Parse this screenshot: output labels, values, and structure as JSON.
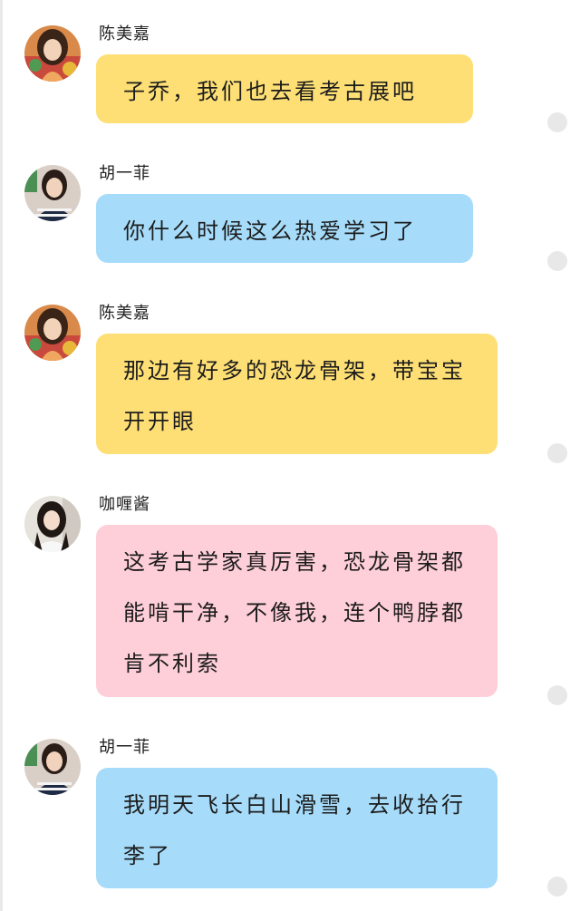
{
  "messages": [
    {
      "sender": "陈美嘉",
      "avatar": "avatar-chen-meijia",
      "text": "子乔，我们也去看考古展吧",
      "color": "yellow"
    },
    {
      "sender": "胡一菲",
      "avatar": "avatar-hu-yifei",
      "text": "你什么时候这么热爱学习了",
      "color": "blue"
    },
    {
      "sender": "陈美嘉",
      "avatar": "avatar-chen-meijia",
      "text": "那边有好多的恐龙骨架，带宝宝开开眼",
      "color": "yellow"
    },
    {
      "sender": "咖喱酱",
      "avatar": "avatar-curry",
      "text": "这考古学家真厉害，恐龙骨架都能啃干净，不像我，连个鸭脖都肯不利索",
      "color": "pink"
    },
    {
      "sender": "胡一菲",
      "avatar": "avatar-hu-yifei",
      "text": "我明天飞长白山滑雪，去收拾行李了",
      "color": "blue"
    }
  ],
  "colors": {
    "yellow_bubble": "#fedf75",
    "blue_bubble": "#a6dcfa",
    "pink_bubble": "#ffcfd9"
  }
}
